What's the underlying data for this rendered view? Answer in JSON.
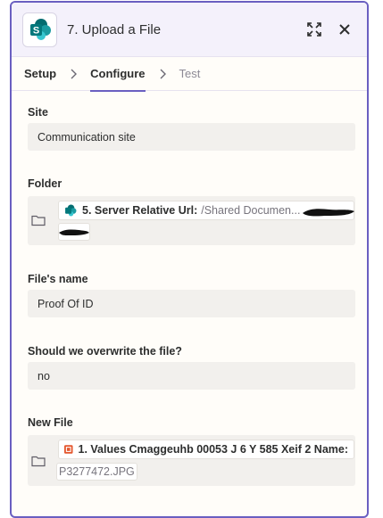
{
  "header": {
    "title": "7. Upload a File",
    "app_icon": "sharepoint-icon",
    "expand_icon": "expand-icon",
    "close_icon": "close-icon"
  },
  "tabs": [
    {
      "label": "Setup",
      "state": "completed"
    },
    {
      "label": "Configure",
      "state": "active"
    },
    {
      "label": "Test",
      "state": "disabled"
    }
  ],
  "fields": {
    "site": {
      "label": "Site",
      "value": "Communication site"
    },
    "folder": {
      "label": "Folder",
      "pill_step": "5. Server Relative Url:",
      "pill_value": "/Shared Documen..."
    },
    "file_name": {
      "label": "File's name",
      "value": "Proof Of ID"
    },
    "overwrite": {
      "label": "Should we overwrite the file?",
      "value": "no"
    },
    "new_file": {
      "label": "New File",
      "pill_step": "1. Values Cmaggeuhb 00053 J 6 Y 585 Xeif 2 Name:",
      "pill_value": "P3277472.JPG"
    }
  },
  "colors": {
    "accent": "#6a5fc1",
    "sharepoint": "#038387",
    "step_icon_orange": "#e4572e",
    "input_bg": "#f2f0ed"
  }
}
